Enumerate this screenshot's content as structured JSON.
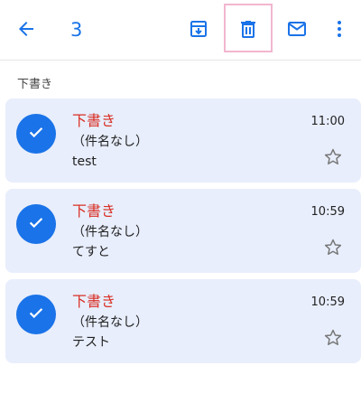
{
  "toolbar": {
    "selected_count": "3",
    "icons": [
      "back-arrow-icon",
      "archive-icon",
      "trash-icon",
      "mark-unread-icon",
      "more-vert-icon"
    ],
    "accent_color": "#1a73e8",
    "highlight_color": "#f2b6cf"
  },
  "section": {
    "label": "下書き"
  },
  "emails": [
    {
      "sender": "下書き",
      "subject": "（件名なし）",
      "snippet": "test",
      "time": "11:00",
      "selected": true
    },
    {
      "sender": "下書き",
      "subject": "（件名なし）",
      "snippet": "てすと",
      "time": "10:59",
      "selected": true
    },
    {
      "sender": "下書き",
      "subject": "（件名なし）",
      "snippet": "テスト",
      "time": "10:59",
      "selected": true
    }
  ],
  "colors": {
    "sender_color": "#d93025",
    "card_background": "#e8eefc"
  }
}
